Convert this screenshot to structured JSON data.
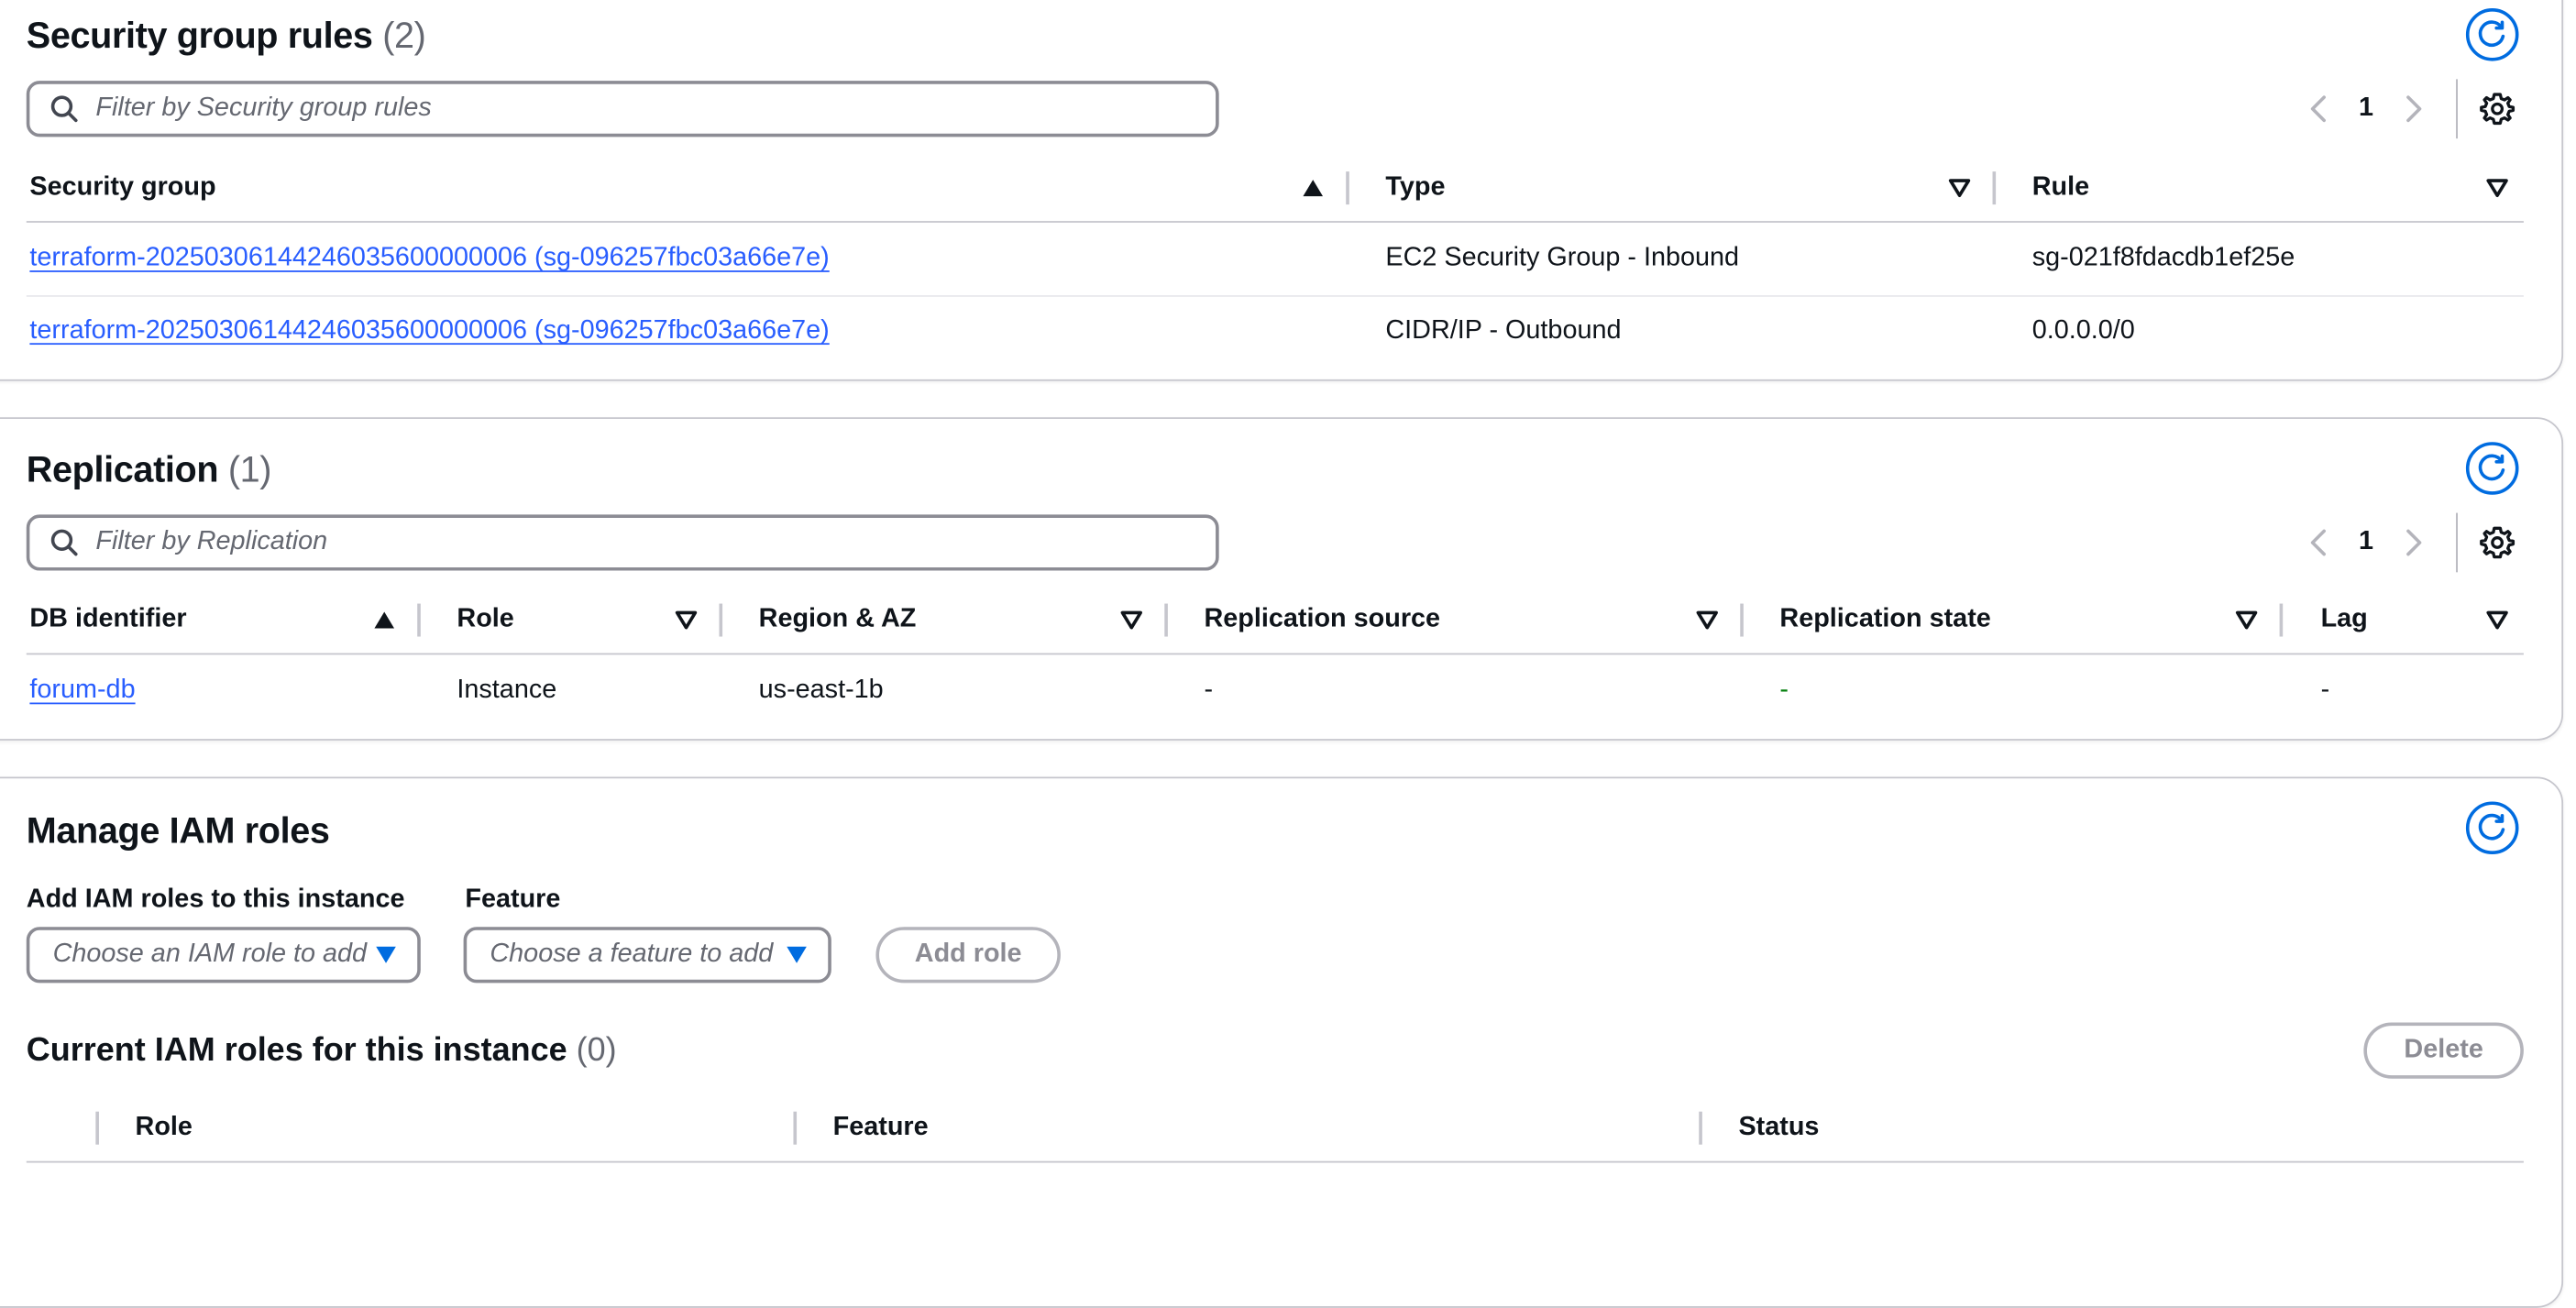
{
  "security_group_rules": {
    "title": "Security group rules",
    "count": "(2)",
    "filter_placeholder": "Filter by Security group rules",
    "page": "1",
    "columns": [
      "Security group",
      "Type",
      "Rule"
    ],
    "rows": [
      {
        "security_group": "terraform-20250306144246035600000006 (sg-096257fbc03a66e7e)",
        "type": "EC2 Security Group - Inbound",
        "rule": "sg-021f8fdacdb1ef25e"
      },
      {
        "security_group": "terraform-20250306144246035600000006 (sg-096257fbc03a66e7e)",
        "type": "CIDR/IP - Outbound",
        "rule": "0.0.0.0/0"
      }
    ]
  },
  "replication": {
    "title": "Replication",
    "count": "(1)",
    "filter_placeholder": "Filter by Replication",
    "page": "1",
    "columns": [
      "DB identifier",
      "Role",
      "Region & AZ",
      "Replication source",
      "Replication state",
      "Lag"
    ],
    "rows": [
      {
        "db_identifier": "forum-db",
        "role": "Instance",
        "region_az": "us-east-1b",
        "replication_source": "-",
        "replication_state": "-",
        "lag": "-"
      }
    ]
  },
  "iam_roles": {
    "title": "Manage IAM roles",
    "add_label": "Add IAM roles to this instance",
    "feature_label": "Feature",
    "role_select_placeholder": "Choose an IAM role to add",
    "feature_select_placeholder": "Choose a feature to add",
    "add_role_button": "Add role",
    "current_title": "Current IAM roles for this instance",
    "current_count": "(0)",
    "delete_button": "Delete",
    "columns": [
      "Role",
      "Feature",
      "Status"
    ]
  },
  "icons": {
    "refresh": "refresh-icon",
    "settings": "gear-icon",
    "search": "search-icon",
    "prev": "chevron-left-icon",
    "next": "chevron-right-icon",
    "sort_asc": "sort-ascending-icon",
    "sort_none": "sort-icon",
    "dropdown": "caret-down-icon"
  },
  "colors": {
    "accent": "#006ce0",
    "link": "#295eff",
    "text": "#0f141a",
    "muted": "#656871",
    "border": "#c6c6cd",
    "success_dash": "#037f0c"
  }
}
